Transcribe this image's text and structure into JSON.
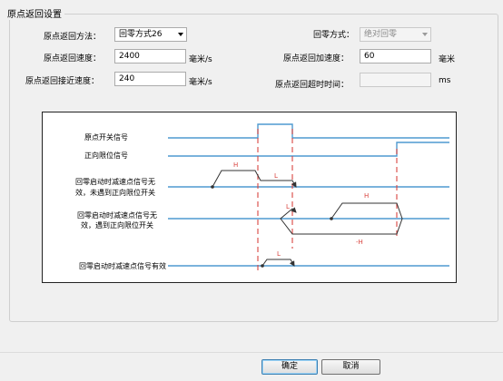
{
  "group": {
    "title": "原点返回设置"
  },
  "form": {
    "method_label": "原点返回方法：",
    "method_value": "回零方式26",
    "mode_label": "回零方式：",
    "mode_value": "绝对回零",
    "speed_label": "原点返回速度：",
    "speed_value": "2400",
    "speed_unit": "毫米/s",
    "accel_label": "原点返回加速度：",
    "accel_value": "60",
    "accel_unit": "毫米",
    "approach_label": "原点返回接近速度：",
    "approach_value": "240",
    "approach_unit": "毫米/s",
    "timeout_label": "原点返回超时时间：",
    "timeout_value": "",
    "timeout_unit": "ms"
  },
  "diagram": {
    "sig_origin": "原点开关信号",
    "sig_limit": "正向限位信号",
    "case1_line1": "回零启动时减速点信号无",
    "case1_line2": "效，未遇到正向限位开关",
    "case2_line1": "回零启动时减速点信号无",
    "case2_line2": "效，遇到正向限位开关",
    "case3": "回零启动时减速点信号有效",
    "lbl_h": "H",
    "lbl_l": "L",
    "lbl_neg_h": "-H",
    "colors": {
      "signal": "#4f9ad0",
      "dashed": "#d9433f",
      "trajectory": "#333333",
      "speed_label": "#d9433f"
    }
  },
  "buttons": {
    "ok": "确定",
    "cancel": "取消"
  }
}
